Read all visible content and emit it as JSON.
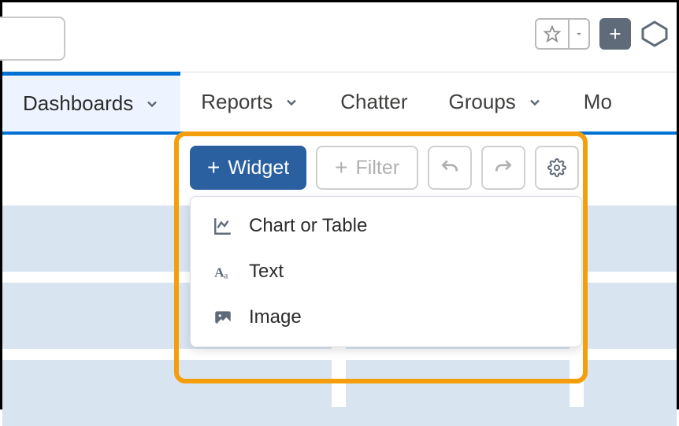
{
  "nav": {
    "tabs": [
      {
        "label": "Dashboards",
        "hasDropdown": true,
        "active": true
      },
      {
        "label": "Reports",
        "hasDropdown": true,
        "active": false
      },
      {
        "label": "Chatter",
        "hasDropdown": false,
        "active": false
      },
      {
        "label": "Groups",
        "hasDropdown": true,
        "active": false
      },
      {
        "label": "Mo",
        "hasDropdown": false,
        "active": false
      }
    ]
  },
  "toolbar": {
    "widget_label": "Widget",
    "filter_label": "Filter"
  },
  "widget_menu": {
    "items": [
      {
        "icon": "chart",
        "label": "Chart or Table"
      },
      {
        "icon": "text",
        "label": "Text"
      },
      {
        "icon": "image",
        "label": "Image"
      }
    ]
  }
}
